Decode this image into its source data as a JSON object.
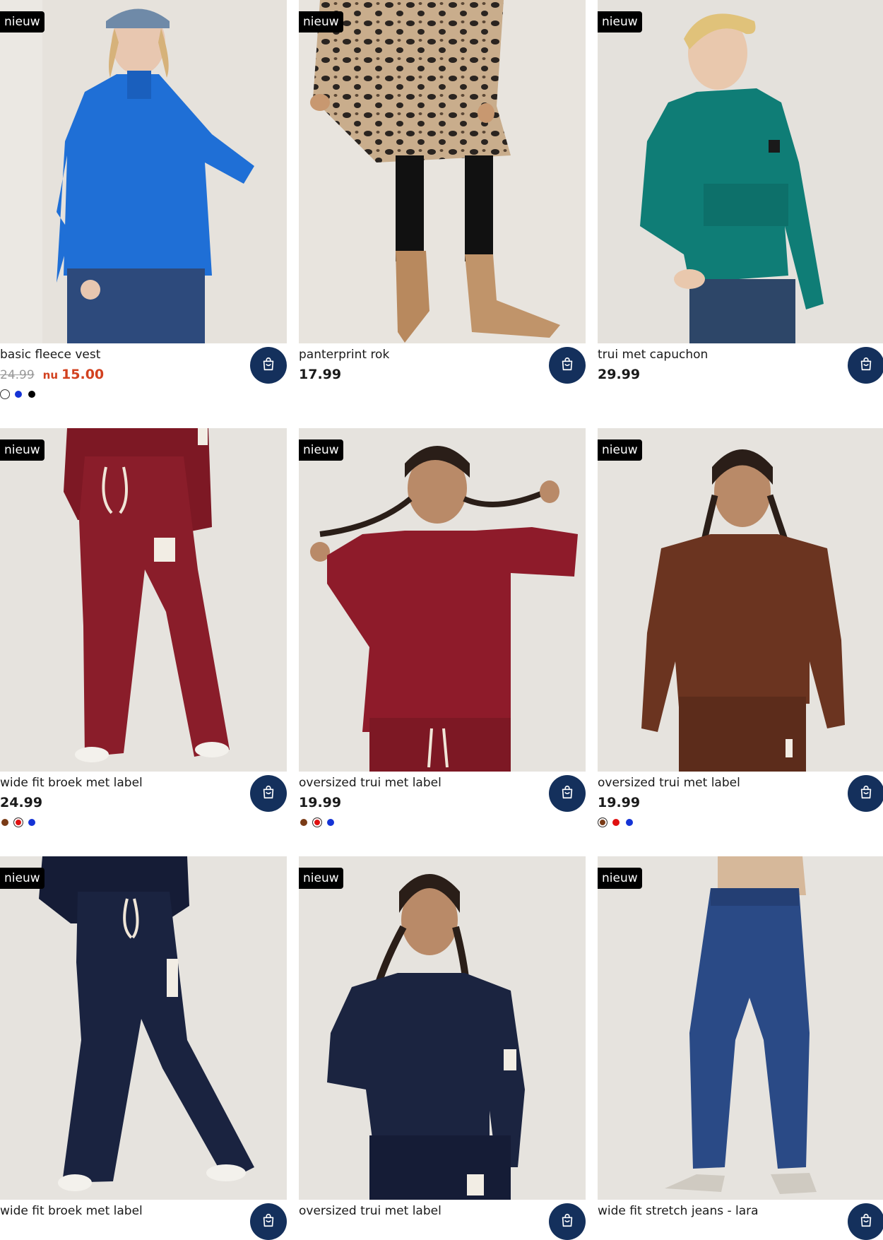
{
  "products": [
    {
      "badge": "nieuw",
      "name": "basic fleece vest",
      "price": "",
      "old_price": "24.99",
      "sale_prefix": "nu",
      "sale_price": "15.00",
      "cart_icon": "shopping-bag-icon",
      "image_colors": {
        "bg": "#e6e2dc",
        "garment": "#1f6fd6",
        "lower": "#2d4a7c",
        "skin": "#e8c7b0"
      },
      "swatches": [
        {
          "color": "#ffffff",
          "name": "white",
          "selected": true
        },
        {
          "color": "#1433d6",
          "name": "blue",
          "selected": false
        },
        {
          "color": "#000000",
          "name": "black",
          "selected": false
        }
      ]
    },
    {
      "badge": "nieuw",
      "name": "panterprint rok",
      "price": "17.99",
      "cart_icon": "shopping-bag-icon",
      "image_colors": {
        "bg": "#e8e4de",
        "garment": "#b89a7a",
        "lower": "#111111",
        "skin": "#c89870"
      },
      "swatches": []
    },
    {
      "badge": "nieuw",
      "name": "trui met capuchon",
      "price": "29.99",
      "cart_icon": "shopping-bag-icon",
      "image_colors": {
        "bg": "#e4e1dc",
        "garment": "#0f7d76",
        "lower": "#2d4668",
        "skin": "#e9c8ad"
      },
      "swatches": []
    },
    {
      "badge": "nieuw",
      "name": "wide fit broek met label",
      "price": "24.99",
      "cart_icon": "shopping-bag-icon",
      "image_colors": {
        "bg": "#e6e3de",
        "garment": "#8a1d2a",
        "lower": "#7d1824",
        "skin": "#b98a68"
      },
      "swatches": [
        {
          "color": "#7a3b17",
          "name": "brown",
          "selected": false
        },
        {
          "color": "#e01010",
          "name": "red",
          "selected": true
        },
        {
          "color": "#1433d6",
          "name": "blue",
          "selected": false
        }
      ]
    },
    {
      "badge": "nieuw",
      "name": "oversized trui met label",
      "price": "19.99",
      "cart_icon": "shopping-bag-icon",
      "image_colors": {
        "bg": "#e6e3de",
        "garment": "#8e1b2a",
        "lower": "#7d1824",
        "skin": "#b98a68"
      },
      "swatches": [
        {
          "color": "#7a3b17",
          "name": "brown",
          "selected": false
        },
        {
          "color": "#e01010",
          "name": "red",
          "selected": true
        },
        {
          "color": "#1433d6",
          "name": "blue",
          "selected": false
        }
      ]
    },
    {
      "badge": "nieuw",
      "name": "oversized trui met label",
      "price": "19.99",
      "cart_icon": "shopping-bag-icon",
      "image_colors": {
        "bg": "#e6e3de",
        "garment": "#6b3420",
        "lower": "#5c2c1b",
        "skin": "#b98a68"
      },
      "swatches": [
        {
          "color": "#7a3b17",
          "name": "brown",
          "selected": true
        },
        {
          "color": "#e01010",
          "name": "red",
          "selected": false
        },
        {
          "color": "#1433d6",
          "name": "blue",
          "selected": false
        }
      ]
    },
    {
      "badge": "nieuw",
      "name": "wide fit broek met label",
      "price": "",
      "cart_icon": "shopping-bag-icon",
      "image_colors": {
        "bg": "#e6e3de",
        "garment": "#1a2340",
        "lower": "#151c36",
        "skin": "#b98a68"
      },
      "swatches": []
    },
    {
      "badge": "nieuw",
      "name": "oversized trui met label",
      "price": "",
      "cart_icon": "shopping-bag-icon",
      "image_colors": {
        "bg": "#e6e3de",
        "garment": "#1b2440",
        "lower": "#151c36",
        "skin": "#b98a68"
      },
      "swatches": []
    },
    {
      "badge": "nieuw",
      "name": "wide fit stretch jeans - lara",
      "price": "",
      "cart_icon": "shopping-bag-icon",
      "image_colors": {
        "bg": "#e6e3de",
        "garment": "#2a4a86",
        "lower": "#2a4a86",
        "skin": "#d6b89a"
      },
      "swatches": []
    }
  ],
  "colors": {
    "cart_button": "#14305c",
    "sale": "#d2411f",
    "badge_bg": "#000000",
    "badge_text": "#ffffff"
  }
}
